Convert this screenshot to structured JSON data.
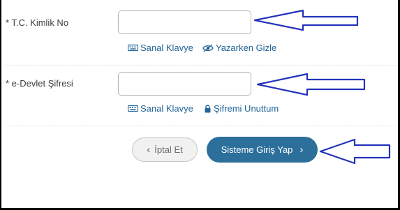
{
  "form": {
    "tckn": {
      "label": "* T.C. Kimlik No",
      "value": "",
      "placeholder": "",
      "virtual_keyboard_label": "Sanal Klavye",
      "hide_while_typing_label": "Yazarken Gizle"
    },
    "password": {
      "label": "* e-Devlet Şifresi",
      "value": "",
      "placeholder": "",
      "virtual_keyboard_label": "Sanal Klavye",
      "forgot_password_label": "Şifremi Unuttum"
    },
    "actions": {
      "cancel_label": "İptal Et",
      "login_label": "Sisteme Giriş Yap"
    }
  },
  "icons": {
    "keyboard": "keyboard-icon",
    "eye": "eye-icon",
    "lock": "lock-icon",
    "chevron_left": "chevron-left-icon",
    "chevron_right": "chevron-right-icon",
    "annotation_arrow": "arrow-left-annotation-icon"
  },
  "colors": {
    "link": "#226598",
    "primary_button": "#2c6f9b",
    "annotation_arrow": "#2233bb"
  }
}
